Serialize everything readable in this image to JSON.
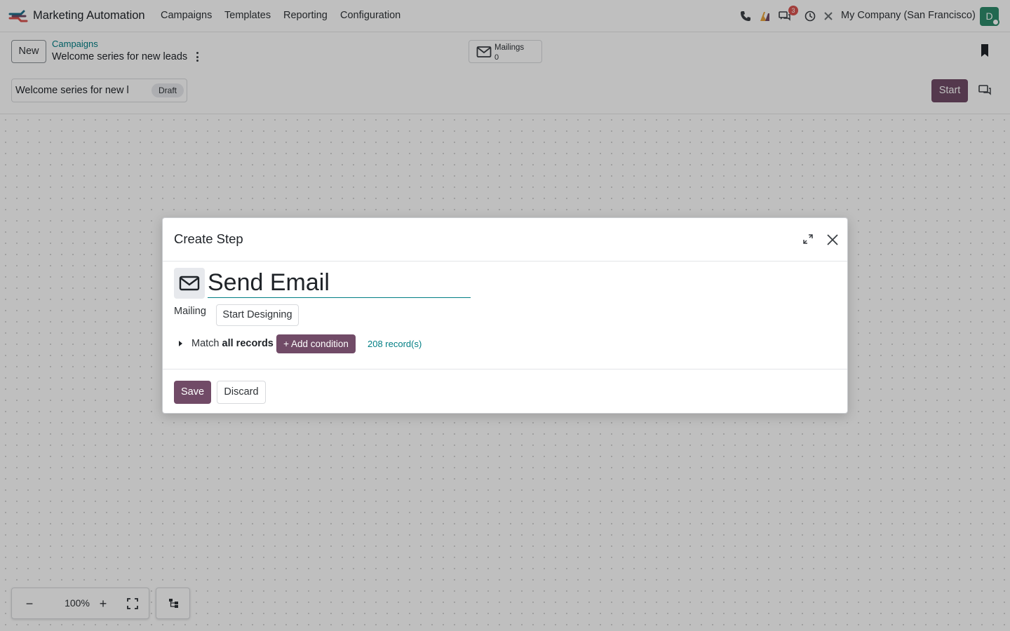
{
  "navbar": {
    "app_name": "Marketing Automation",
    "menu": [
      "Campaigns",
      "Templates",
      "Reporting",
      "Configuration"
    ],
    "messages_count": "3",
    "company": "My Company (San Francisco)",
    "avatar_initial": "D"
  },
  "control_panel": {
    "new_label": "New",
    "breadcrumb_parent": "Campaigns",
    "breadcrumb_current": "Welcome series for new leads",
    "stat_button": {
      "label": "Mailings",
      "value": "0"
    },
    "title_value": "Welcome series for new l",
    "status": "Draft",
    "start_label": "Start"
  },
  "canvas": {
    "zoom_level": "100%",
    "zoom_out": "−",
    "zoom_in": "+"
  },
  "modal": {
    "title": "Create Step",
    "activity_name": "Send Email",
    "mailing_label": "Mailing",
    "start_designing_label": "Start Designing",
    "match_prefix": "Match",
    "match_bold": "all records",
    "add_condition_label": "+ Add condition",
    "records_count": "208 record(s)",
    "save_label": "Save",
    "discard_label": "Discard"
  },
  "colors": {
    "brand": "#714b67",
    "link": "#017e84"
  }
}
